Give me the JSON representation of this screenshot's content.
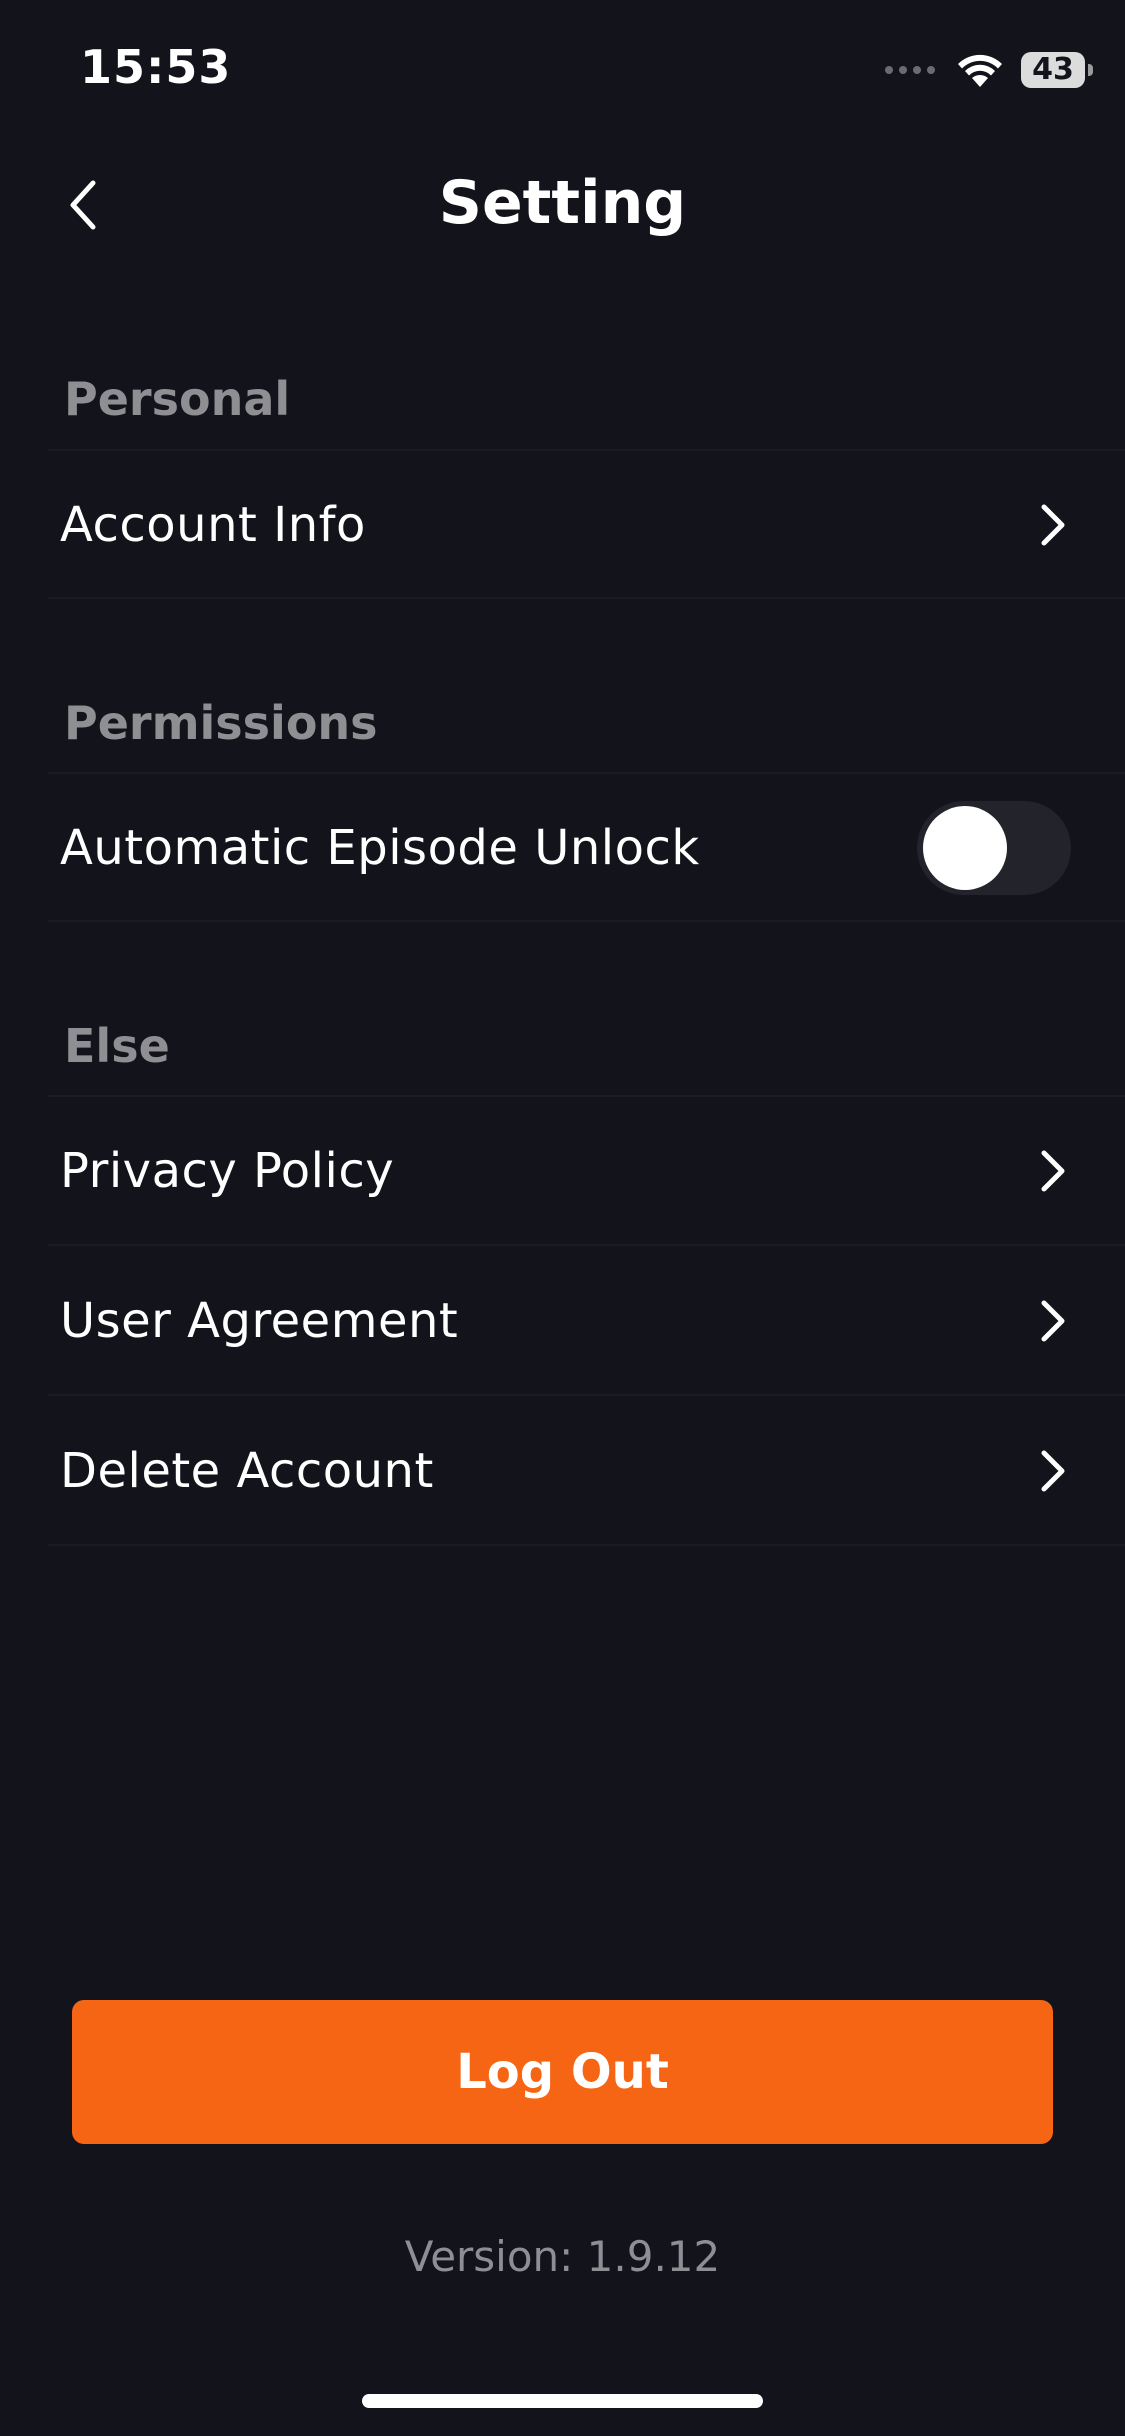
{
  "status_bar": {
    "time": "15:53",
    "battery": "43",
    "signal_icon": "signal-dots-icon",
    "wifi_icon": "wifi-icon"
  },
  "nav": {
    "title": "Setting",
    "back_icon": "chevron-left-icon"
  },
  "sections": [
    {
      "header": "Personal",
      "items": [
        {
          "label": "Account Info",
          "type": "link"
        }
      ]
    },
    {
      "header": "Permissions",
      "items": [
        {
          "label": "Automatic Episode Unlock",
          "type": "toggle",
          "value": false
        }
      ]
    },
    {
      "header": "Else",
      "items": [
        {
          "label": "Privacy Policy",
          "type": "link"
        },
        {
          "label": "User Agreement",
          "type": "link"
        },
        {
          "label": "Delete Account",
          "type": "link"
        }
      ]
    }
  ],
  "logout": {
    "label": "Log Out"
  },
  "version": {
    "text": "Version: 1.9.12"
  },
  "colors": {
    "background": "#12131b",
    "accent": "#f66514",
    "section_header": "#8e8e93",
    "toggle_track": "#23242b"
  }
}
